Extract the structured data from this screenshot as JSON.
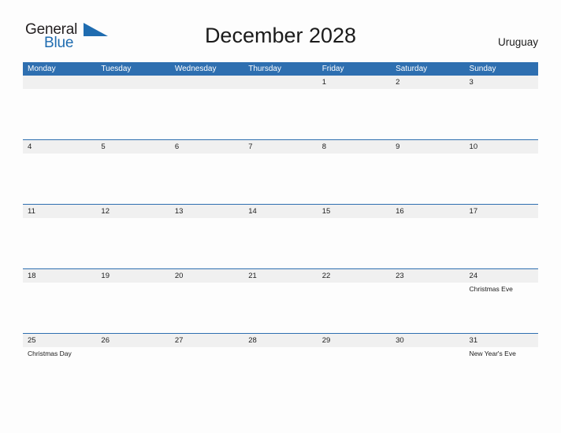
{
  "brand": {
    "name_part1": "General",
    "name_part2": "Blue",
    "flag_icon": "triangle-flag-icon",
    "accent_color": "#1f6cb0"
  },
  "header": {
    "title": "December 2028",
    "country": "Uruguay"
  },
  "theme": {
    "header_blue": "#2e6fb0",
    "date_strip_bg": "#f0f0f0",
    "page_bg": "#fdfdfd",
    "text_color": "#1b1b1b"
  },
  "calendar": {
    "weekdays": [
      "Monday",
      "Tuesday",
      "Wednesday",
      "Thursday",
      "Friday",
      "Saturday",
      "Sunday"
    ],
    "weeks": [
      {
        "days": [
          {
            "date": "",
            "events": []
          },
          {
            "date": "",
            "events": []
          },
          {
            "date": "",
            "events": []
          },
          {
            "date": "",
            "events": []
          },
          {
            "date": "1",
            "events": []
          },
          {
            "date": "2",
            "events": []
          },
          {
            "date": "3",
            "events": []
          }
        ]
      },
      {
        "days": [
          {
            "date": "4",
            "events": []
          },
          {
            "date": "5",
            "events": []
          },
          {
            "date": "6",
            "events": []
          },
          {
            "date": "7",
            "events": []
          },
          {
            "date": "8",
            "events": []
          },
          {
            "date": "9",
            "events": []
          },
          {
            "date": "10",
            "events": []
          }
        ]
      },
      {
        "days": [
          {
            "date": "11",
            "events": []
          },
          {
            "date": "12",
            "events": []
          },
          {
            "date": "13",
            "events": []
          },
          {
            "date": "14",
            "events": []
          },
          {
            "date": "15",
            "events": []
          },
          {
            "date": "16",
            "events": []
          },
          {
            "date": "17",
            "events": []
          }
        ]
      },
      {
        "days": [
          {
            "date": "18",
            "events": []
          },
          {
            "date": "19",
            "events": []
          },
          {
            "date": "20",
            "events": []
          },
          {
            "date": "21",
            "events": []
          },
          {
            "date": "22",
            "events": []
          },
          {
            "date": "23",
            "events": []
          },
          {
            "date": "24",
            "events": [
              "Christmas Eve"
            ]
          }
        ]
      },
      {
        "days": [
          {
            "date": "25",
            "events": [
              "Christmas Day"
            ]
          },
          {
            "date": "26",
            "events": []
          },
          {
            "date": "27",
            "events": []
          },
          {
            "date": "28",
            "events": []
          },
          {
            "date": "29",
            "events": []
          },
          {
            "date": "30",
            "events": []
          },
          {
            "date": "31",
            "events": [
              "New Year's Eve"
            ]
          }
        ]
      }
    ]
  }
}
